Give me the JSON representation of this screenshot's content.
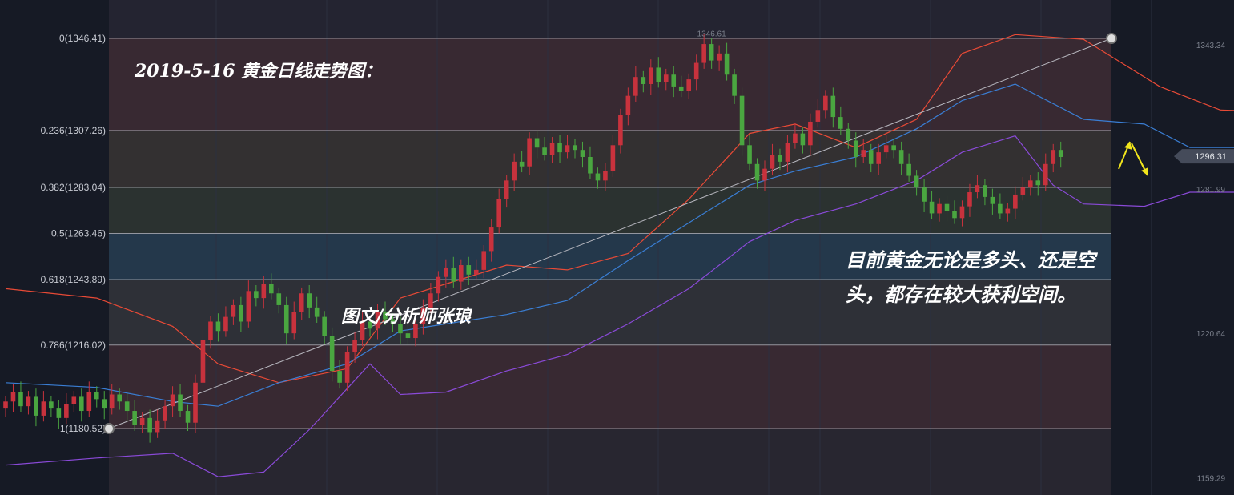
{
  "chart_data": {
    "type": "candlestick",
    "title": "2019-5-16   黄金日线走势图：",
    "author": "图文/分析师张琅",
    "commentary": [
      "目前黄金无论是多头、还是空",
      "头，都存在较大获利空间。"
    ],
    "y_range": [
      1150,
      1358
    ],
    "axis_ticks": [
      {
        "value": 1343.34,
        "label": "1343.34"
      },
      {
        "value": 1281.99,
        "label": "1281.99"
      },
      {
        "value": 1220.64,
        "label": "1220.64"
      },
      {
        "value": 1159.29,
        "label": "1159.29"
      }
    ],
    "current_price": {
      "value": 1296.31,
      "label": "1296.31"
    },
    "high_marker": {
      "value": 1346.61,
      "label": "1346.61"
    },
    "fibonacci": [
      {
        "ratio": "0",
        "value": 1346.41,
        "label": "0(1346.41)"
      },
      {
        "ratio": "0.236",
        "value": 1307.26,
        "label": "0.236(1307.26)"
      },
      {
        "ratio": "0.382",
        "value": 1283.04,
        "label": "0.382(1283.04)"
      },
      {
        "ratio": "0.5",
        "value": 1263.46,
        "label": "0.5(1263.46)"
      },
      {
        "ratio": "0.618",
        "value": 1243.89,
        "label": "0.618(1243.89)"
      },
      {
        "ratio": "0.786",
        "value": 1216.02,
        "label": "0.786(1216.02)"
      },
      {
        "ratio": "1",
        "value": 1180.52,
        "label": "1(1180.52)"
      }
    ],
    "zone_colors": [
      "#3a2a33",
      "#353131",
      "#2c3430",
      "#253a4d",
      "#2f3138",
      "#3a2a33"
    ],
    "close_path": [
      1192,
      1196,
      1190,
      1194,
      1186,
      1192,
      1189,
      1185,
      1191,
      1194,
      1188,
      1196,
      1193,
      1189,
      1195,
      1192,
      1188,
      1182,
      1185,
      1179,
      1184,
      1190,
      1195,
      1188,
      1183,
      1200,
      1218,
      1226,
      1222,
      1228,
      1233,
      1226,
      1239,
      1236,
      1242,
      1238,
      1233,
      1221,
      1230,
      1238,
      1232,
      1228,
      1220,
      1205,
      1200,
      1213,
      1218,
      1226,
      1223,
      1230,
      1227,
      1225,
      1221,
      1219,
      1225,
      1232,
      1238,
      1245,
      1249,
      1243,
      1250,
      1246,
      1248,
      1256,
      1266,
      1278,
      1286,
      1294,
      1292,
      1304,
      1300,
      1297,
      1302,
      1298,
      1301,
      1299,
      1296,
      1289,
      1286,
      1290,
      1301,
      1314,
      1322,
      1330,
      1327,
      1334,
      1328,
      1331,
      1326,
      1324,
      1329,
      1336,
      1344,
      1337,
      1340,
      1331,
      1322,
      1301,
      1293,
      1286,
      1291,
      1297,
      1294,
      1302,
      1306,
      1301,
      1311,
      1316,
      1322,
      1313,
      1308,
      1303,
      1296,
      1299,
      1293,
      1298,
      1301,
      1299,
      1293,
      1288,
      1283,
      1277,
      1272,
      1276,
      1273,
      1270,
      1275,
      1281,
      1284,
      1279,
      1276,
      1272,
      1274,
      1280,
      1283,
      1286,
      1284,
      1293,
      1299,
      1296
    ],
    "moving_averages": {
      "upper": {
        "color": "#e84a36",
        "path": [
          [
            0,
            1240
          ],
          [
            12,
            1236
          ],
          [
            22,
            1224
          ],
          [
            28,
            1208
          ],
          [
            36,
            1200
          ],
          [
            45,
            1206
          ],
          [
            52,
            1236
          ],
          [
            58,
            1242
          ],
          [
            66,
            1250
          ],
          [
            74,
            1248
          ],
          [
            82,
            1255
          ],
          [
            90,
            1278
          ],
          [
            98,
            1306
          ],
          [
            104,
            1310
          ],
          [
            112,
            1300
          ],
          [
            120,
            1312
          ],
          [
            126,
            1340
          ],
          [
            133,
            1348
          ],
          [
            142,
            1346
          ],
          [
            152,
            1326
          ],
          [
            160,
            1316
          ],
          [
            170,
            1315
          ],
          [
            176,
            1308
          ],
          [
            180,
            1301
          ],
          [
            185,
            1300
          ]
        ]
      },
      "middle": {
        "color": "#3a7ed4",
        "path": [
          [
            0,
            1200
          ],
          [
            12,
            1198
          ],
          [
            22,
            1192
          ],
          [
            28,
            1190
          ],
          [
            36,
            1200
          ],
          [
            45,
            1208
          ],
          [
            52,
            1222
          ],
          [
            58,
            1225
          ],
          [
            66,
            1229
          ],
          [
            74,
            1235
          ],
          [
            82,
            1252
          ],
          [
            90,
            1268
          ],
          [
            98,
            1284
          ],
          [
            104,
            1290
          ],
          [
            112,
            1296
          ],
          [
            120,
            1308
          ],
          [
            126,
            1320
          ],
          [
            133,
            1327
          ],
          [
            142,
            1312
          ],
          [
            150,
            1310
          ],
          [
            156,
            1300
          ],
          [
            162,
            1300
          ],
          [
            170,
            1290
          ],
          [
            176,
            1286
          ],
          [
            180,
            1285
          ],
          [
            185,
            1287
          ]
        ]
      },
      "lower": {
        "color": "#8a4ad8",
        "path": [
          [
            0,
            1165
          ],
          [
            12,
            1168
          ],
          [
            22,
            1170
          ],
          [
            28,
            1160
          ],
          [
            34,
            1162
          ],
          [
            40,
            1180
          ],
          [
            48,
            1208
          ],
          [
            52,
            1195
          ],
          [
            58,
            1196
          ],
          [
            66,
            1205
          ],
          [
            74,
            1212
          ],
          [
            82,
            1225
          ],
          [
            90,
            1240
          ],
          [
            98,
            1260
          ],
          [
            104,
            1269
          ],
          [
            112,
            1276
          ],
          [
            120,
            1286
          ],
          [
            126,
            1298
          ],
          [
            133,
            1305
          ],
          [
            138,
            1284
          ],
          [
            142,
            1276
          ],
          [
            150,
            1275
          ],
          [
            156,
            1281
          ],
          [
            162,
            1281
          ],
          [
            170,
            1280
          ],
          [
            176,
            1268
          ],
          [
            180,
            1266
          ],
          [
            185,
            1265
          ]
        ]
      }
    },
    "trendline": {
      "from": 1180.52,
      "to": 1346.41,
      "color": "#b9b9c1"
    },
    "up_color": "#c8323d",
    "down_color": "#4aa640",
    "arrow_color": "#f2e61c"
  }
}
